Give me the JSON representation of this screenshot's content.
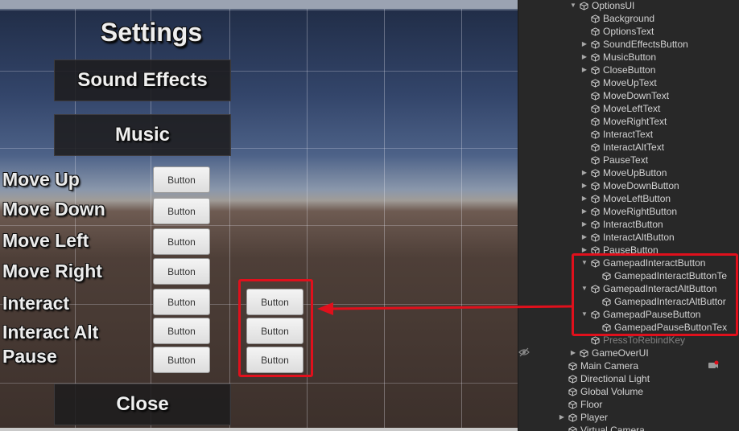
{
  "scene": {
    "title": "Settings",
    "buttons": {
      "sound_effects": "Sound Effects",
      "music": "Music",
      "close": "Close"
    },
    "bindings": [
      {
        "label": "Move Up",
        "button": "Button"
      },
      {
        "label": "Move Down",
        "button": "Button"
      },
      {
        "label": "Move Left",
        "button": "Button"
      },
      {
        "label": "Move Right",
        "button": "Button"
      },
      {
        "label": "Interact",
        "button": "Button",
        "gamepad_button": "Button"
      },
      {
        "label": "Interact Alt",
        "button": "Button",
        "gamepad_button": "Button"
      },
      {
        "label": "Pause",
        "button": "Button",
        "gamepad_button": "Button"
      }
    ]
  },
  "hierarchy": {
    "items": [
      {
        "label": "OptionsUI",
        "depth": 0,
        "fold": "expanded"
      },
      {
        "label": "Background",
        "depth": 1,
        "fold": "none"
      },
      {
        "label": "OptionsText",
        "depth": 1,
        "fold": "none"
      },
      {
        "label": "SoundEffectsButton",
        "depth": 1,
        "fold": "collapsed"
      },
      {
        "label": "MusicButton",
        "depth": 1,
        "fold": "collapsed"
      },
      {
        "label": "CloseButton",
        "depth": 1,
        "fold": "collapsed"
      },
      {
        "label": "MoveUpText",
        "depth": 1,
        "fold": "none"
      },
      {
        "label": "MoveDownText",
        "depth": 1,
        "fold": "none"
      },
      {
        "label": "MoveLeftText",
        "depth": 1,
        "fold": "none"
      },
      {
        "label": "MoveRightText",
        "depth": 1,
        "fold": "none"
      },
      {
        "label": "InteractText",
        "depth": 1,
        "fold": "none"
      },
      {
        "label": "InteractAltText",
        "depth": 1,
        "fold": "none"
      },
      {
        "label": "PauseText",
        "depth": 1,
        "fold": "none"
      },
      {
        "label": "MoveUpButton",
        "depth": 1,
        "fold": "collapsed"
      },
      {
        "label": "MoveDownButton",
        "depth": 1,
        "fold": "collapsed"
      },
      {
        "label": "MoveLeftButton",
        "depth": 1,
        "fold": "collapsed"
      },
      {
        "label": "MoveRightButton",
        "depth": 1,
        "fold": "collapsed"
      },
      {
        "label": "InteractButton",
        "depth": 1,
        "fold": "collapsed"
      },
      {
        "label": "InteractAltButton",
        "depth": 1,
        "fold": "collapsed"
      },
      {
        "label": "PauseButton",
        "depth": 1,
        "fold": "collapsed"
      },
      {
        "label": "GamepadInteractButton",
        "depth": 1,
        "fold": "expanded"
      },
      {
        "label": "GamepadInteractButtonTe",
        "depth": 2,
        "fold": "none"
      },
      {
        "label": "GamepadInteractAltButton",
        "depth": 1,
        "fold": "expanded"
      },
      {
        "label": "GamepadInteractAltButtor",
        "depth": 2,
        "fold": "none"
      },
      {
        "label": "GamepadPauseButton",
        "depth": 1,
        "fold": "expanded"
      },
      {
        "label": "GamepadPauseButtonTex",
        "depth": 2,
        "fold": "none"
      },
      {
        "label": "PressToRebindKey",
        "depth": 1,
        "fold": "none",
        "dim": true
      },
      {
        "label": "GameOverUI",
        "depth": 0,
        "fold": "collapsed"
      },
      {
        "label": "Main Camera",
        "depth": -1,
        "fold": "none"
      },
      {
        "label": "Directional Light",
        "depth": -1,
        "fold": "none"
      },
      {
        "label": "Global Volume",
        "depth": -1,
        "fold": "none"
      },
      {
        "label": "Floor",
        "depth": -1,
        "fold": "none"
      },
      {
        "label": "Player",
        "depth": -1,
        "fold": "collapsed"
      },
      {
        "label": "Virtual Camera",
        "depth": -1,
        "fold": "none"
      }
    ]
  },
  "colors": {
    "highlight": "#e0101c",
    "panel_bg": "#282828",
    "hierarchy_text": "#d2d2d2"
  }
}
